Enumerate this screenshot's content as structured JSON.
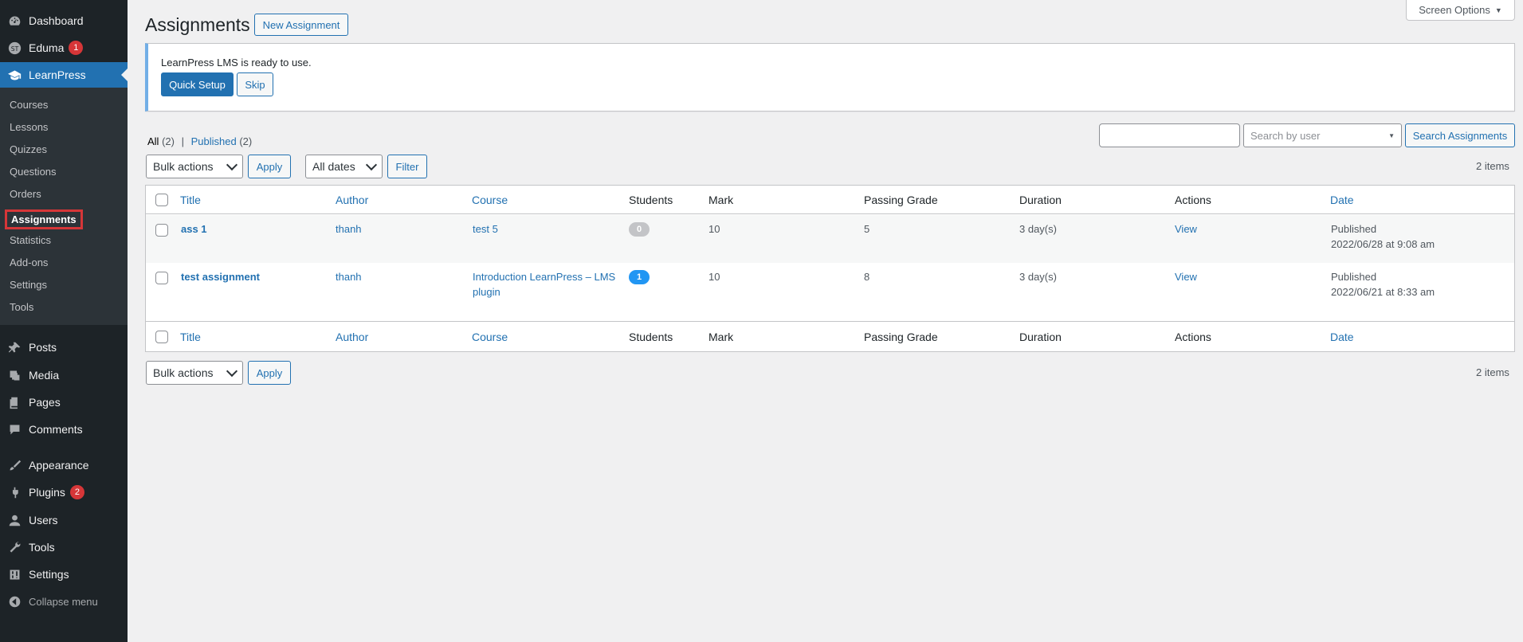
{
  "sidebar": {
    "menu": [
      {
        "label": "Dashboard",
        "icon": "dashboard-icon"
      },
      {
        "label": "Eduma",
        "icon": "eduma-icon",
        "badge": "1"
      },
      {
        "label": "LearnPress",
        "icon": "graduation-cap-icon"
      },
      {
        "label": "Posts",
        "icon": "pin-icon"
      },
      {
        "label": "Media",
        "icon": "media-icon"
      },
      {
        "label": "Pages",
        "icon": "pages-icon"
      },
      {
        "label": "Comments",
        "icon": "comment-icon"
      },
      {
        "label": "Appearance",
        "icon": "brush-icon"
      },
      {
        "label": "Plugins",
        "icon": "plugin-icon",
        "badge": "2"
      },
      {
        "label": "Users",
        "icon": "user-icon"
      },
      {
        "label": "Tools",
        "icon": "wrench-icon"
      },
      {
        "label": "Settings",
        "icon": "settings-icon"
      }
    ],
    "submenu": [
      "Courses",
      "Lessons",
      "Quizzes",
      "Questions",
      "Orders",
      "Assignments",
      "Statistics",
      "Add-ons",
      "Settings",
      "Tools"
    ],
    "collapse_label": "Collapse menu"
  },
  "header": {
    "title": "Assignments",
    "new_button": "New Assignment",
    "screen_options": "Screen Options"
  },
  "notice": {
    "text": "LearnPress LMS is ready to use.",
    "primary_button": "Quick Setup",
    "secondary_button": "Skip"
  },
  "filters": {
    "all_label": "All",
    "all_count": "(2)",
    "published_label": "Published",
    "published_count": "(2)",
    "search_user_placeholder": "Search by user",
    "search_button": "Search Assignments",
    "bulk_actions": "Bulk actions",
    "apply": "Apply",
    "all_dates": "All dates",
    "filter": "Filter",
    "items_count": "2 items"
  },
  "table": {
    "columns": [
      "Title",
      "Author",
      "Course",
      "Students",
      "Mark",
      "Passing Grade",
      "Duration",
      "Actions",
      "Date"
    ],
    "rows": [
      {
        "title": "ass 1",
        "author": "thanh",
        "course_line1": "test 5",
        "course_line2": "",
        "students": "0",
        "mark": "10",
        "passing": "5",
        "duration": "3 day(s)",
        "action": "View",
        "status": "Published",
        "date": "2022/06/28 at 9:08 am"
      },
      {
        "title": "test assignment",
        "author": "thanh",
        "course_line1": "Introduction LearnPress – LMS",
        "course_line2": "plugin",
        "students": "1",
        "mark": "10",
        "passing": "8",
        "duration": "3 day(s)",
        "action": "View",
        "status": "Published",
        "date": "2022/06/21 at 8:33 am"
      }
    ]
  },
  "colors": {
    "accent": "#2271b1",
    "sidebar": "#1d2327",
    "badge": "#d63638",
    "students_zero": "#c3c4c7",
    "students_active": "#2196f3"
  }
}
